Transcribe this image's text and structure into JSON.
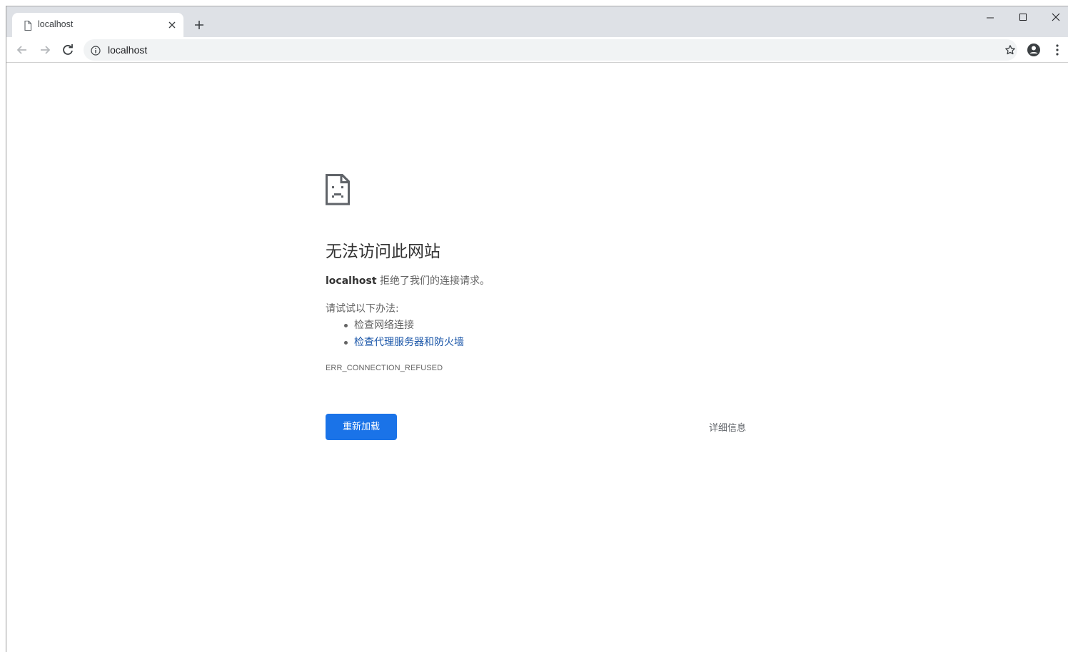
{
  "tab": {
    "title": "localhost",
    "favicon": "page-icon",
    "close": "close-icon"
  },
  "window_controls": [
    "minimize-icon",
    "maximize-icon",
    "close-icon"
  ],
  "toolbar": {
    "back": "arrow-left-icon",
    "forward": "arrow-right-icon",
    "reload": "reload-icon",
    "address": "localhost",
    "site_info": "info-icon",
    "bookmark": "star-icon",
    "profile": "account-circle-icon",
    "menu": "more-vert-icon"
  },
  "error_page": {
    "icon": "sad-page-icon",
    "heading": "无法访问此网站",
    "host": "localhost",
    "message": " 拒绝了我们的连接请求。",
    "suggestions_heading": "请试试以下办法:",
    "suggestions": [
      {
        "label": "检查网络连接",
        "link": false
      },
      {
        "label": "检查代理服务器和防火墙",
        "link": true
      }
    ],
    "error_code": "ERR_CONNECTION_REFUSED",
    "reload_label": "重新加载",
    "details_label": "详细信息"
  },
  "colors": {
    "tabstrip_bg": "#dee1e6",
    "omnibox_bg": "#f1f3f4",
    "primary_button": "#1a73e8",
    "link": "#1a56a8",
    "body_text": "#646464"
  }
}
